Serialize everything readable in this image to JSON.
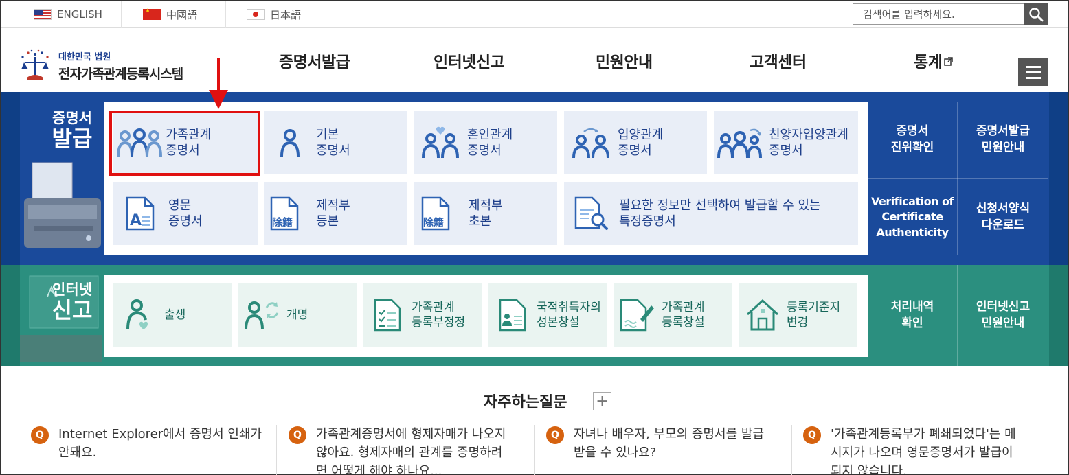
{
  "languages": [
    {
      "label": "ENGLISH",
      "icon": "us-flag-icon"
    },
    {
      "label": "中國語",
      "icon": "china-flag-icon"
    },
    {
      "label": "日本語",
      "icon": "japan-flag-icon"
    }
  ],
  "search": {
    "placeholder": "검색어를 입력하세요."
  },
  "logo": {
    "small": "대한민국 법원",
    "big": "전자가족관계등록시스템"
  },
  "gnb": [
    "증명서발급",
    "인터넷신고",
    "민원안내",
    "고객센터",
    "통계"
  ],
  "cert": {
    "title1": "증명서",
    "title2": "발급",
    "tiles": [
      {
        "line1": "가족관계",
        "line2": "증명서"
      },
      {
        "line1": "기본",
        "line2": "증명서"
      },
      {
        "line1": "혼인관계",
        "line2": "증명서"
      },
      {
        "line1": "입양관계",
        "line2": "증명서"
      },
      {
        "line1": "친양자입양관계",
        "line2": "증명서"
      },
      {
        "line1": "영문",
        "line2": "증명서"
      },
      {
        "line1": "제적부",
        "line2": "등본"
      },
      {
        "line1": "제적부",
        "line2": "초본"
      },
      {
        "line1": "필요한 정보만 선택하여 발급할 수 있는",
        "line2": "특정증명서"
      }
    ],
    "side": [
      {
        "line1": "증명서",
        "line2": "진위확인"
      },
      {
        "line1": "증명서발급",
        "line2": "민원안내"
      },
      {
        "line1": "Verification of",
        "line2": "Certificate",
        "line3": "Authenticity"
      },
      {
        "line1": "신청서양식",
        "line2": "다운로드"
      }
    ],
    "jeok_label": "除籍"
  },
  "net": {
    "title1": "인터넷",
    "title2": "신고",
    "tiles": [
      {
        "line1": "출생",
        "line2": ""
      },
      {
        "line1": "개명",
        "line2": ""
      },
      {
        "line1": "가족관계",
        "line2": "등록부정정"
      },
      {
        "line1": "국적취득자의",
        "line2": "성본창설"
      },
      {
        "line1": "가족관계",
        "line2": "등록창설"
      },
      {
        "line1": "등록기준지",
        "line2": "변경"
      }
    ],
    "side": [
      {
        "line1": "처리내역",
        "line2": "확인"
      },
      {
        "line1": "인터넷신고",
        "line2": "민원안내"
      }
    ]
  },
  "faq": {
    "title": "자주하는질문",
    "more": "+",
    "badge": "Q",
    "items": [
      {
        "line1": "Internet Explorer에서 증명서 인쇄가",
        "line2": "안돼요.",
        "line3": ""
      },
      {
        "line1": "가족관계증명서에 형제자매가 나오지",
        "line2": "않아요. 형제자매의 관계를 증명하려",
        "line3": "면 어떻게 해야 하나요..."
      },
      {
        "line1": "자녀나 배우자, 부모의 증명서를 발급",
        "line2": "받을 수 있나요?",
        "line3": ""
      },
      {
        "line1": "'가족관계등록부가 폐쇄되었다'는 메",
        "line2": "시지가 나오며 영문증명서가 발급이",
        "line3": "되지 않습니다."
      }
    ]
  },
  "colors": {
    "cert_bg": "#1a4a9b",
    "net_bg": "#2b8f7f",
    "highlight": "#e01010",
    "faq_badge": "#d6620f"
  }
}
